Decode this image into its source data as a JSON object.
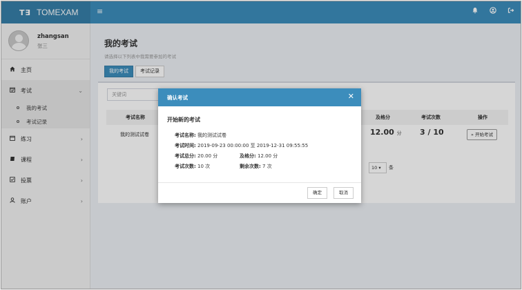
{
  "topbar": {
    "logo_mark": "T∃",
    "logo_text": "TOMEXAM",
    "menu_toggle": "≡",
    "icons": [
      "bell-icon",
      "user-circle-icon",
      "sign-out-icon"
    ]
  },
  "user": {
    "username": "zhangsan",
    "real_name": "张三"
  },
  "sidebar": {
    "home": "主页",
    "exam": "考试",
    "exam_sub": [
      "我的考试",
      "考试记录"
    ],
    "practice": "练习",
    "course": "课程",
    "vote": "投票",
    "account": "账户"
  },
  "page": {
    "title": "我的考试",
    "subtitle": "请选择以下列表中我需要参加的考试",
    "tabs": [
      "我的考试",
      "考试记录"
    ]
  },
  "table": {
    "search_placeholder": "关键词",
    "headers": {
      "name": "考试名称",
      "pass": "及格分",
      "times": "考试次数",
      "action": "操作"
    },
    "row": {
      "name": "我的测试试卷",
      "pass_value": "12.00",
      "pass_unit": "分",
      "times": "3 / 10",
      "action": "» 开始考试"
    },
    "pager": {
      "page_size": "10 ▾",
      "unit": "条"
    }
  },
  "modal": {
    "title": "确认考试",
    "close": "✕",
    "heading": "开始新的考试",
    "name_label": "考试名称:",
    "name_value": "我的测试试卷",
    "time_label": "考试时间:",
    "time_value": "2019-09-23 00:00:00 至 2019-12-31 09:55:55",
    "total_label": "考试总分:",
    "total_value": "20.00 分",
    "pass_label": "及格分:",
    "pass_value": "12.00 分",
    "times_label": "考试次数:",
    "times_value": "10 次",
    "remain_label": "剩余次数:",
    "remain_value": "7 次",
    "confirm": "确定",
    "cancel": "取消"
  },
  "colors": {
    "primary": "#3c8dbc",
    "logo_bg": "#367fa9"
  }
}
